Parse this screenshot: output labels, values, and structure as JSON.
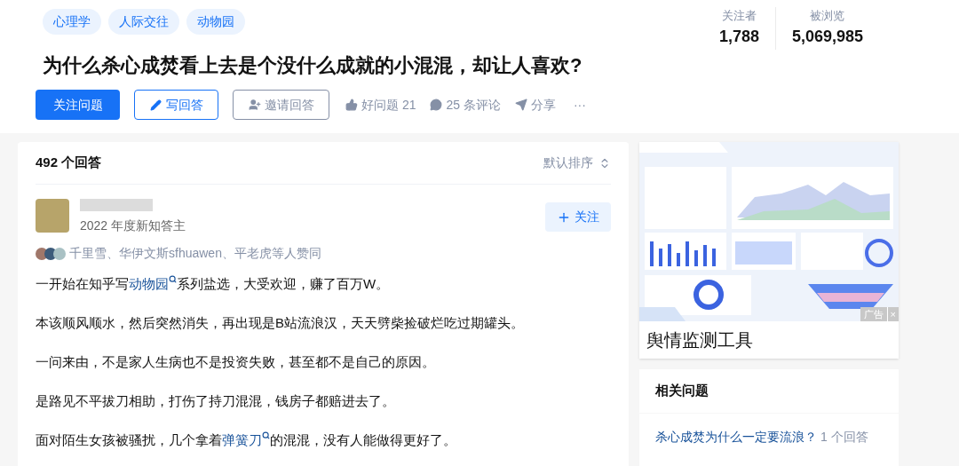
{
  "tags": [
    "心理学",
    "人际交往",
    "动物园"
  ],
  "question": {
    "title": "为什么杀心成焚看上去是个没什么成就的小混混，却让人喜欢?"
  },
  "actions": {
    "follow": "关注问题",
    "write": "写回答",
    "invite": "邀请回答",
    "good": "好问题 21",
    "comments": "25 条评论",
    "share": "分享",
    "more": "···"
  },
  "stats": [
    {
      "label": "关注者",
      "value": "1,788"
    },
    {
      "label": "被浏览",
      "value": "5,069,985"
    }
  ],
  "answers": {
    "count": "492 个回答",
    "sort": "默认排序",
    "author": {
      "badge": "2022 年度新知答主",
      "follow": "关注"
    },
    "upvoters": "千里雪、华伊文斯sfhuawen、平老虎等人赞同",
    "paragraphs": [
      [
        {
          "kind": "text",
          "text": "一开始在知乎写"
        },
        {
          "kind": "link",
          "text": "动物园"
        },
        {
          "kind": "text",
          "text": "系列盐选，大受欢迎，赚了百万W。"
        }
      ],
      [
        {
          "kind": "text",
          "text": "本该顺风顺水，然后突然消失，再出现是B站流浪汉，天天劈柴捡破烂吃过期罐头。"
        }
      ],
      [
        {
          "kind": "text",
          "text": "一问来由，不是家人生病也不是投资失败，甚至都不是自己的原因。"
        }
      ],
      [
        {
          "kind": "text",
          "text": "是路见不平拔刀相助，打伤了持刀混混，钱房子都赔进去了。"
        }
      ],
      [
        {
          "kind": "text",
          "text": "面对陌生女孩被骚扰，几个拿着"
        },
        {
          "kind": "link",
          "text": "弹簧刀"
        },
        {
          "kind": "text",
          "text": "的混混，没有人能做得更好了。"
        }
      ]
    ]
  },
  "ad": {
    "kind": "picture",
    "badge": "广告",
    "close": "×",
    "title": "舆情监测工具"
  },
  "related": {
    "heading": "相关问题",
    "items": [
      {
        "question": "杀心成焚为什么一定要流浪？",
        "answers": "1 个回答"
      }
    ]
  }
}
